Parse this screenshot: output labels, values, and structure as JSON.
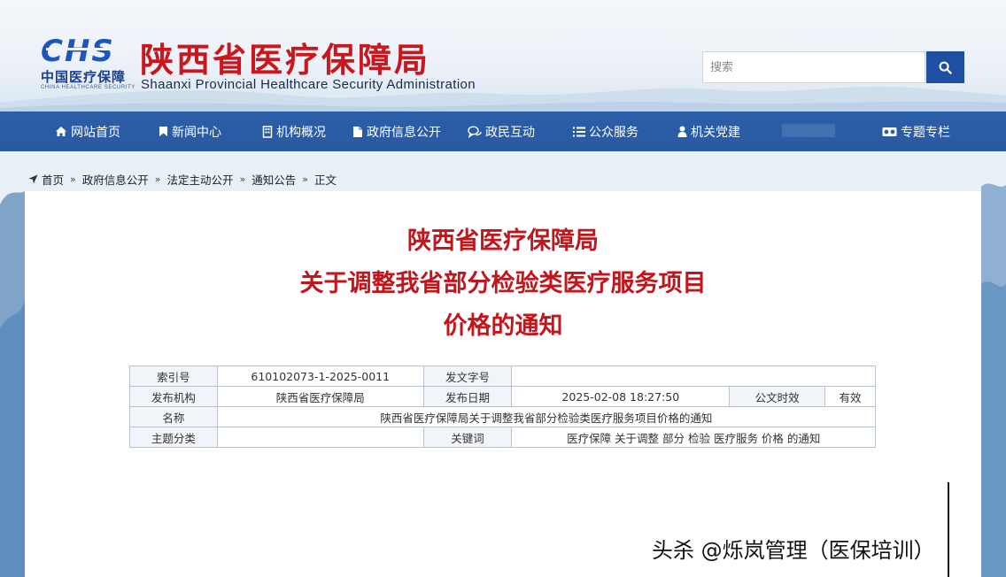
{
  "header": {
    "logo_mark": "CHS",
    "logo_cn": "中国医疗保障",
    "logo_en": "CHINA HEALTHCARE SECURITY",
    "site_title": "陕西省医疗保障局",
    "site_subtitle": "Shaanxi Provincial Healthcare Security Administration",
    "search_placeholder": "搜索"
  },
  "nav": {
    "items": [
      {
        "label": "网站首页",
        "icon": "home-icon"
      },
      {
        "label": "新闻中心",
        "icon": "bookmark-icon"
      },
      {
        "label": "机构概况",
        "icon": "building-icon"
      },
      {
        "label": "政府信息公开",
        "icon": "document-icon"
      },
      {
        "label": "政民互动",
        "icon": "chat-icon"
      },
      {
        "label": "公众服务",
        "icon": "list-icon"
      },
      {
        "label": "机关党建",
        "icon": "user-icon"
      },
      {
        "label": "",
        "icon": ""
      },
      {
        "label": "专题专栏",
        "icon": "video-icon"
      }
    ]
  },
  "breadcrumb": [
    "首页",
    "政府信息公开",
    "法定主动公开",
    "通知公告",
    "正文"
  ],
  "document": {
    "title_lines": [
      "陕西省医疗保障局",
      "关于调整我省部分检验类医疗服务项目",
      "价格的通知"
    ],
    "meta": {
      "index_label": "索引号",
      "index_value": "610102073-1-2025-0011",
      "doc_no_label": "发文字号",
      "doc_no_value": "",
      "issuer_label": "发布机构",
      "issuer_value": "陕西省医疗保障局",
      "date_label": "发布日期",
      "date_value": "2025-02-08 18:27:50",
      "validity_label": "公文时效",
      "validity_value": "有效",
      "name_label": "名称",
      "name_value": "陕西省医疗保障局关于调整我省部分检验类医疗服务项目价格的通知",
      "topic_label": "主题分类",
      "topic_value": "",
      "keywords_label": "关键词",
      "keywords_value": "医疗保障 关于调整 部分 检验 医疗服务 价格 的通知"
    }
  },
  "watermark": "头杀 @烁岚管理（医保培训）",
  "colors": {
    "brand_red": "#c0161c",
    "nav_blue": "#2b5ea8",
    "search_blue": "#1f4fa3"
  }
}
